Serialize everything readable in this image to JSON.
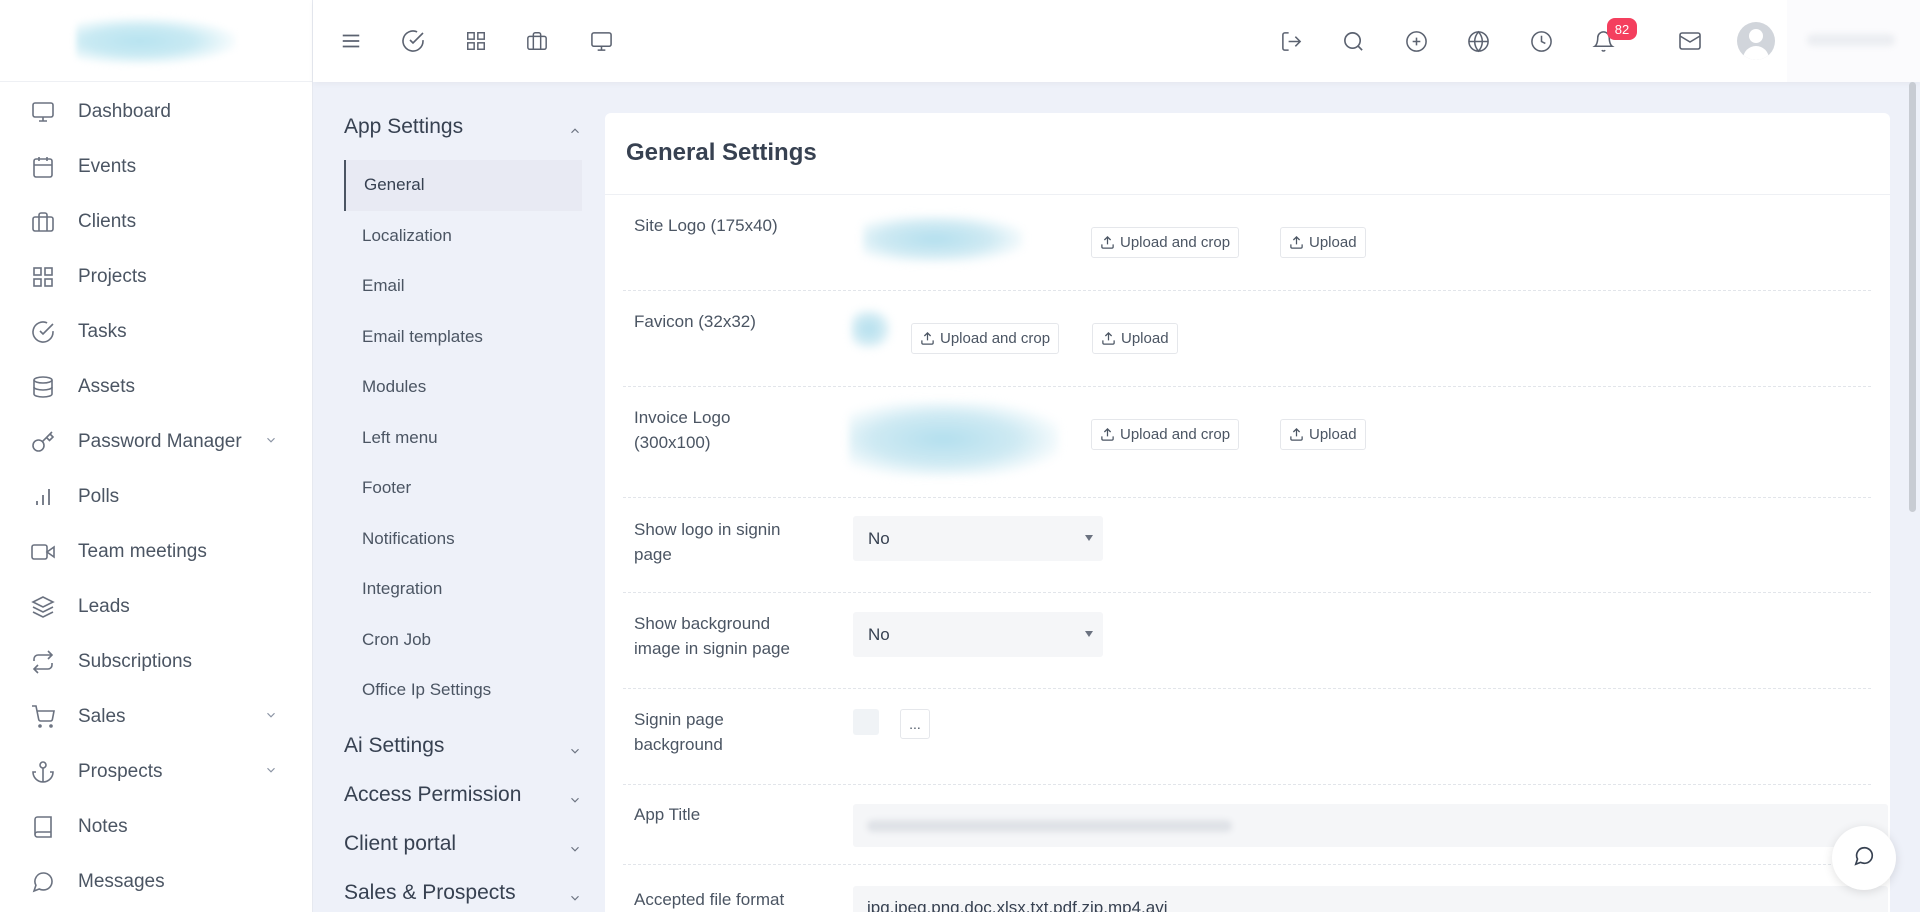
{
  "sidebar": {
    "items": [
      {
        "label": "Dashboard",
        "icon": "monitor-icon"
      },
      {
        "label": "Events",
        "icon": "calendar-icon"
      },
      {
        "label": "Clients",
        "icon": "briefcase-icon"
      },
      {
        "label": "Projects",
        "icon": "grid-icon"
      },
      {
        "label": "Tasks",
        "icon": "check-circle-icon"
      },
      {
        "label": "Assets",
        "icon": "database-icon"
      },
      {
        "label": "Password Manager",
        "icon": "key-icon"
      },
      {
        "label": "Polls",
        "icon": "bar-chart-icon"
      },
      {
        "label": "Team meetings",
        "icon": "video-icon"
      },
      {
        "label": "Leads",
        "icon": "layers-icon"
      },
      {
        "label": "Subscriptions",
        "icon": "repeat-icon"
      },
      {
        "label": "Sales",
        "icon": "cart-icon"
      },
      {
        "label": "Prospects",
        "icon": "anchor-icon"
      },
      {
        "label": "Notes",
        "icon": "book-icon"
      },
      {
        "label": "Messages",
        "icon": "message-icon"
      }
    ]
  },
  "topbar": {
    "left_icons": [
      "menu-icon",
      "check-circle-icon",
      "grid-icon",
      "briefcase-icon",
      "monitor-icon"
    ],
    "right_icons": [
      "logout-icon",
      "search-icon",
      "plus-circle-icon",
      "globe-icon",
      "clock-icon",
      "bell-icon",
      "mail-icon"
    ],
    "notification_count": "82"
  },
  "settings_menu": {
    "app_settings": {
      "label": "App Settings",
      "items": [
        "General",
        "Localization",
        "Email",
        "Email templates",
        "Modules",
        "Left menu",
        "Footer",
        "Notifications",
        "Integration",
        "Cron Job",
        "Office Ip Settings"
      ]
    },
    "groups": [
      "Ai Settings",
      "Access Permission",
      "Client portal",
      "Sales & Prospects"
    ]
  },
  "general": {
    "title": "General Settings",
    "site_logo_label": "Site Logo (175x40)",
    "favicon_label": "Favicon (32x32)",
    "invoice_logo_label": "Invoice Logo (300x100)",
    "upload_crop_label": "Upload and crop",
    "upload_label": "Upload",
    "show_logo_label": "Show logo in signin page",
    "show_logo_value": "No",
    "show_bg_label": "Show background image in signin page",
    "show_bg_value": "No",
    "signin_bg_label": "Signin page background",
    "signin_bg_button": "...",
    "app_title_label": "App Title",
    "accepted_label": "Accepted file format",
    "accepted_value": "jpg,jpeg,png,doc,xlsx,txt,pdf,zip,mp4,avi"
  },
  "colors": {
    "accent": "#f43f5e",
    "page_bg": "#eef1f9"
  }
}
